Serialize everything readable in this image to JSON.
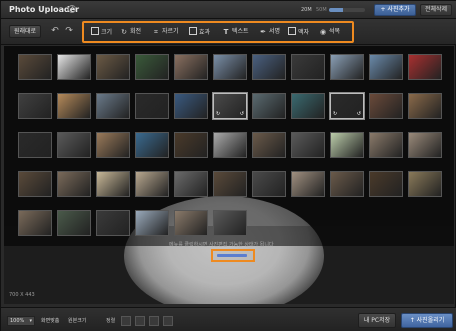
{
  "app": {
    "title": "Photo Uploader",
    "help": "?"
  },
  "capacity": {
    "label_20": "20M",
    "label_50": "50M",
    "used_fraction": 0.4
  },
  "header": {
    "add_label": "+ 사진추가",
    "delete_all_label": "전체삭제"
  },
  "toolbar": {
    "original_label": "원래대로",
    "undo": "↶",
    "redo": "↷",
    "tools": [
      {
        "label": "크기",
        "icon": "resize-icon"
      },
      {
        "label": "회전",
        "icon": "rotate-icon"
      },
      {
        "label": "자르기",
        "icon": "crop-icon"
      },
      {
        "label": "효과",
        "icon": "effect-icon"
      },
      {
        "label": "텍스트",
        "icon": "text-icon"
      },
      {
        "label": "서명",
        "icon": "signature-icon"
      },
      {
        "label": "액자",
        "icon": "frame-icon"
      },
      {
        "label": "석복",
        "icon": "circle-icon"
      }
    ]
  },
  "thumbnails": {
    "rows": 5,
    "cols": 11,
    "last_row_count": 6,
    "colors": [
      [
        "#5a4a3a",
        "#e5e5e5",
        "#6b5a45",
        "#3a5a3a",
        "#8a7060",
        "#7a8fa8",
        "#4a6080",
        "#3a3a3a",
        "#8a9fb5",
        "#6a8aaa",
        "#a83030"
      ],
      [
        "#404040",
        "#b58a5a",
        "#6a7a8a",
        "#2a2a2a",
        "#3a5a80",
        "#4a4a4a",
        "#5a6a70",
        "#3a6a70",
        "#2a2a2a",
        "#6a4a3a",
        "#8a6a4a"
      ],
      [
        "#2a2a2a",
        "#5a5a5a",
        "#9a7a5a",
        "#3a6a90",
        "#4a3a2a",
        "#aaa",
        "#6a5a4a",
        "#5a5a5a",
        "#bca",
        "#8a7a6a",
        "#9a8a7a"
      ],
      [
        "#5a4a3a",
        "#7a6a5a",
        "#c8b898",
        "#b8a890",
        "#6a6a6a",
        "#5a4a3a",
        "#4a4a4a",
        "#a09080",
        "#6a5a4a",
        "#4a3a2a",
        "#8a7a5a"
      ],
      [
        "#7a6a5a",
        "#4a5a4a",
        "#3a3a3a",
        "#9aaabb",
        "#8a7a6a",
        "#5a5a5a"
      ]
    ],
    "selected": [
      [
        1,
        5
      ],
      [
        1,
        8
      ]
    ]
  },
  "workspace": {
    "hint": "메뉴를 클릭하시면 사진편집 가능한 상태가 됩니다",
    "image_size": "700 X 443"
  },
  "statusbar": {
    "zoom": "100%",
    "fit_label": "화면맞춤",
    "original_size_label": "원본크기",
    "sort_label": "정렬",
    "save_label": "내 PC저장",
    "upload_label": "사진올리기"
  },
  "colors": {
    "accent": "#ee8a20",
    "primary": "#4a70aa"
  }
}
